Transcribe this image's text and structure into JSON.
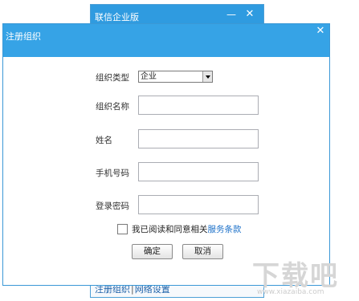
{
  "background_window": {
    "title": "联信企业版",
    "minimize_glyph": "—",
    "close_glyph": "✕",
    "footer": {
      "register_link": "注册组织",
      "separator": "|",
      "network_link": "网络设置"
    }
  },
  "dialog": {
    "title": "注册组织",
    "close_glyph": "✕",
    "fields": {
      "org_type_label": "组织类型",
      "org_type_value": "企业",
      "org_name_label": "组织名称",
      "org_name_value": "",
      "name_label": "姓名",
      "name_value": "",
      "phone_label": "手机号码",
      "phone_value": "",
      "password_label": "登录密码",
      "password_value": ""
    },
    "agree_text": "我已阅读和同意相关",
    "agree_link": "服务条款",
    "agree_checked": false,
    "ok_label": "确定",
    "cancel_label": "取消"
  },
  "watermark": {
    "logo_text": "下载吧",
    "url": "www.xiazaiba.com"
  },
  "colors": {
    "title_bar": "#36a3e6",
    "link": "#1a6fc8"
  }
}
